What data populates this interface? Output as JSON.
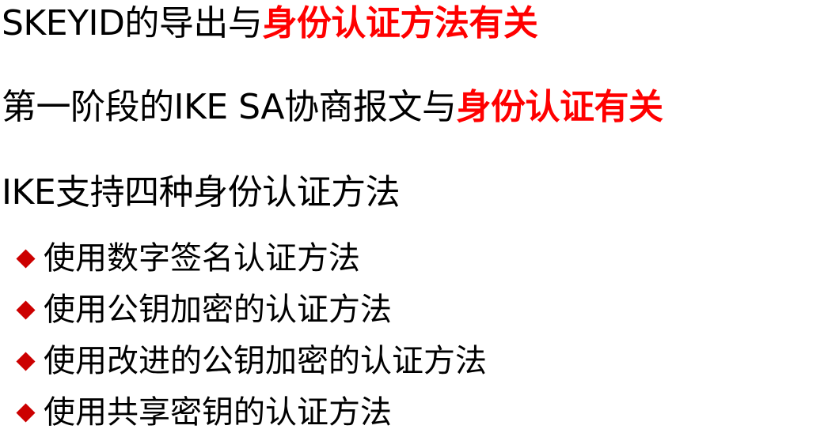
{
  "colors": {
    "text": "#000000",
    "highlight": "#ff0000",
    "bullet": "#cc0000"
  },
  "lines": [
    {
      "normal": "SKEYID的导出与",
      "highlight": "身份认证方法有关"
    },
    {
      "normal": "第一阶段的IKE SA协商报文与",
      "highlight": "身份认证有关"
    },
    {
      "normal": "IKE支持四种身份认证方法"
    }
  ],
  "bullet_icon": "diamond-bullet-icon",
  "methods": [
    "使用数字签名认证方法",
    "使用公钥加密的认证方法",
    "使用改进的公钥加密的认证方法",
    "使用共享密钥的认证方法"
  ]
}
